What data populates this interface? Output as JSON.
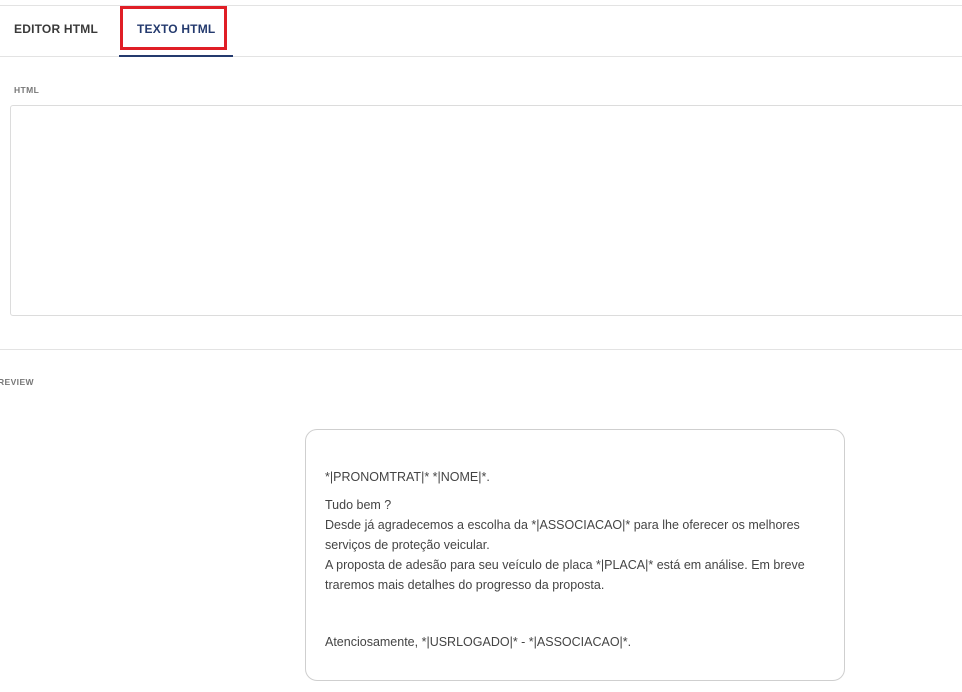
{
  "tabs": [
    {
      "label": "EDITOR HTML",
      "active": false
    },
    {
      "label": "TEXTO HTML",
      "active": true
    }
  ],
  "html_section": {
    "label": "HTML",
    "value": ""
  },
  "preview_section": {
    "label": "REVIEW",
    "greeting": "*|PRONOMTRAT|* *|NOME|*.",
    "body_lines": [
      "Tudo bem ?",
      "Desde já agradecemos a escolha da *|ASSOCIACAO|* para lhe oferecer os melhores",
      "serviços de proteção veicular.",
      "A proposta de adesão para seu veículo de placa *|PLACA|* está em análise. Em breve",
      "traremos mais detalhes do progresso da proposta."
    ],
    "signoff": "Atenciosamente, *|USRLOGADO|* - *|ASSOCIACAO|*."
  },
  "colors": {
    "active_tab": "#243a6e",
    "highlight": "#e01e26"
  }
}
